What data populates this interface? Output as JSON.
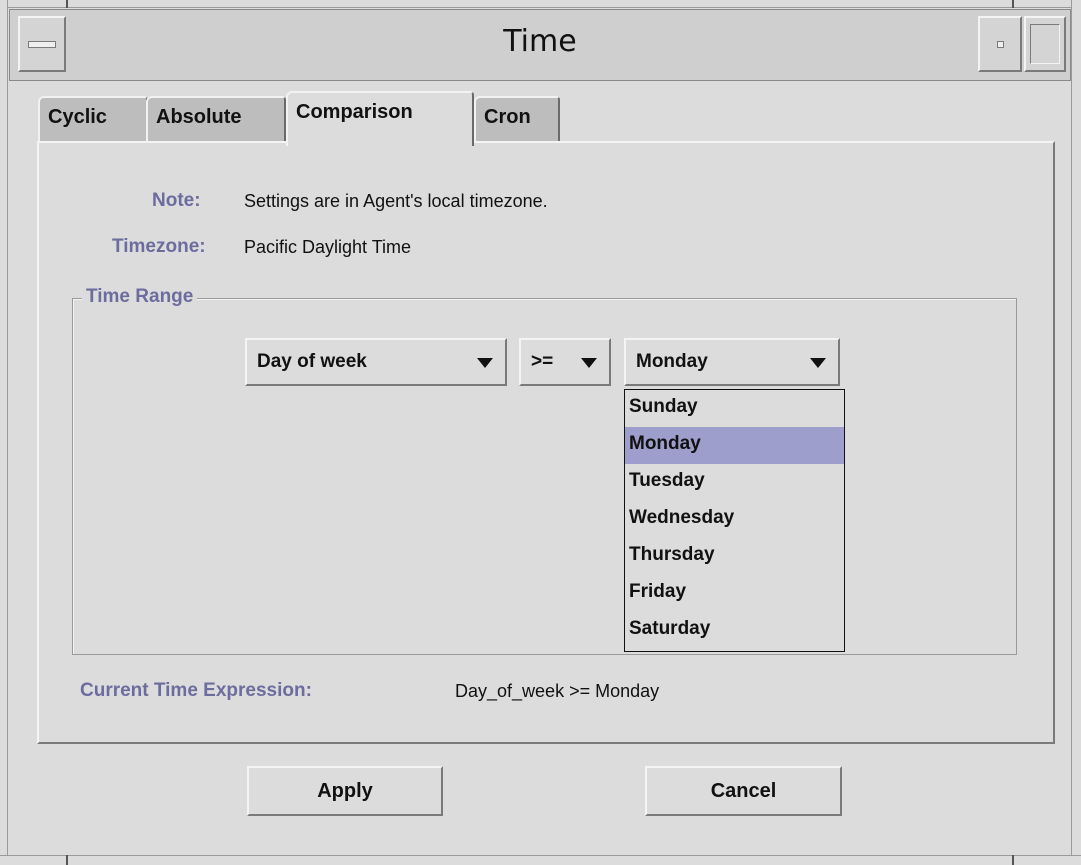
{
  "window": {
    "title": "Time"
  },
  "tabs": [
    {
      "label": "Cyclic",
      "active": false
    },
    {
      "label": "Absolute",
      "active": false
    },
    {
      "label": "Comparison",
      "active": true
    },
    {
      "label": "Cron",
      "active": false
    }
  ],
  "note": {
    "label": "Note:",
    "text": "Settings are in Agent's local timezone."
  },
  "timezone": {
    "label": "Timezone:",
    "value": "Pacific Daylight Time"
  },
  "time_range": {
    "legend": "Time Range",
    "field_select": {
      "value": "Day of week"
    },
    "operator_select": {
      "value": ">="
    },
    "value_select": {
      "value": "Monday",
      "options": [
        "Sunday",
        "Monday",
        "Tuesday",
        "Wednesday",
        "Thursday",
        "Friday",
        "Saturday"
      ],
      "highlighted": "Monday"
    }
  },
  "expression": {
    "label": "Current Time Expression:",
    "value": "Day_of_week >= Monday"
  },
  "buttons": {
    "apply": "Apply",
    "cancel": "Cancel"
  },
  "colors": {
    "label_purple": "#6c6c9f",
    "selection": "#9e9ecc",
    "background": "#dcdcdc"
  }
}
